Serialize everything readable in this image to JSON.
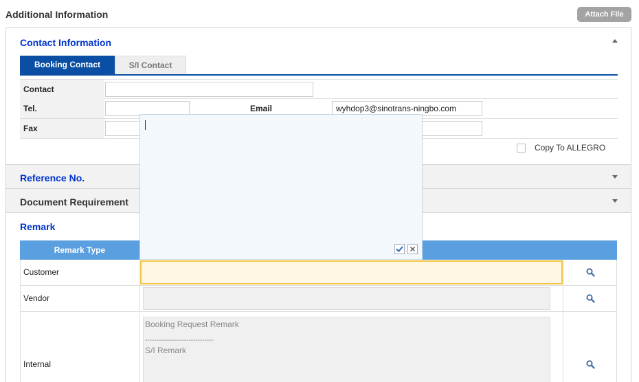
{
  "header": {
    "title": "Additional Information",
    "attach_label": "Attach File"
  },
  "contact": {
    "section_title": "Contact Information",
    "tabs": [
      {
        "label": "Booking Contact"
      },
      {
        "label": "S/I Contact"
      }
    ],
    "fields": {
      "contact_label": "Contact",
      "contact_value": "",
      "tel_label": "Tel.",
      "tel_value": "",
      "email_label": "Email",
      "email_value": "wyhdop3@sinotrans-ningbo.com",
      "fax_label": "Fax",
      "fax_value": ""
    },
    "copy_label": "Copy To ALLEGRO"
  },
  "sections": {
    "reference": "Reference No.",
    "document": "Document Requirement",
    "remark": "Remark"
  },
  "remark_table": {
    "header_label": "Remark Type",
    "rows": [
      {
        "label": "Customer",
        "value": ""
      },
      {
        "label": "Vendor",
        "value": ""
      },
      {
        "label": "Internal",
        "line1": "Booking Request Remark",
        "line2": "------------------------------",
        "line3": "S/I Remark"
      }
    ]
  },
  "icons": {
    "collapse": "chevron-up-icon",
    "expand": "chevron-down-icon",
    "search": "magnifier-icon",
    "confirm": "check-icon",
    "close": "close-icon"
  },
  "colors": {
    "accent_blue": "#0a4fa3",
    "section_link": "#0033cc",
    "table_header": "#5a9fe0",
    "focus_border": "#f5c542"
  }
}
